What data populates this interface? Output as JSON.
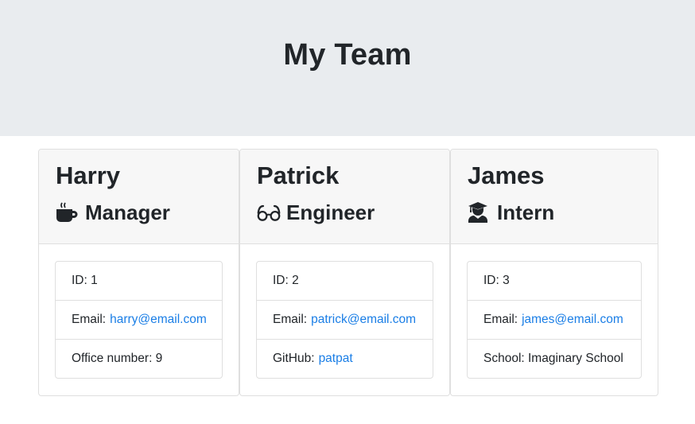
{
  "header": {
    "title": "My Team"
  },
  "colors": {
    "link": "#1a7ee6",
    "jumbotron_bg": "#e9ecef",
    "card_header_bg": "#f7f7f7"
  },
  "team": [
    {
      "name": "Harry",
      "role": "Manager",
      "icon": "mug-hot-icon",
      "id_label": "ID: 1",
      "email_label": "Email:",
      "email": "harry@email.com",
      "extra_label": "Office number: 9",
      "extra_link": ""
    },
    {
      "name": "Patrick",
      "role": "Engineer",
      "icon": "glasses-icon",
      "id_label": "ID: 2",
      "email_label": "Email:",
      "email": "patrick@email.com",
      "extra_label": "GitHub:",
      "extra_link": "patpat"
    },
    {
      "name": "James",
      "role": "Intern",
      "icon": "user-graduate-icon",
      "id_label": "ID: 3",
      "email_label": "Email:",
      "email": "james@email.com",
      "extra_label": "School: Imaginary School",
      "extra_link": ""
    }
  ]
}
